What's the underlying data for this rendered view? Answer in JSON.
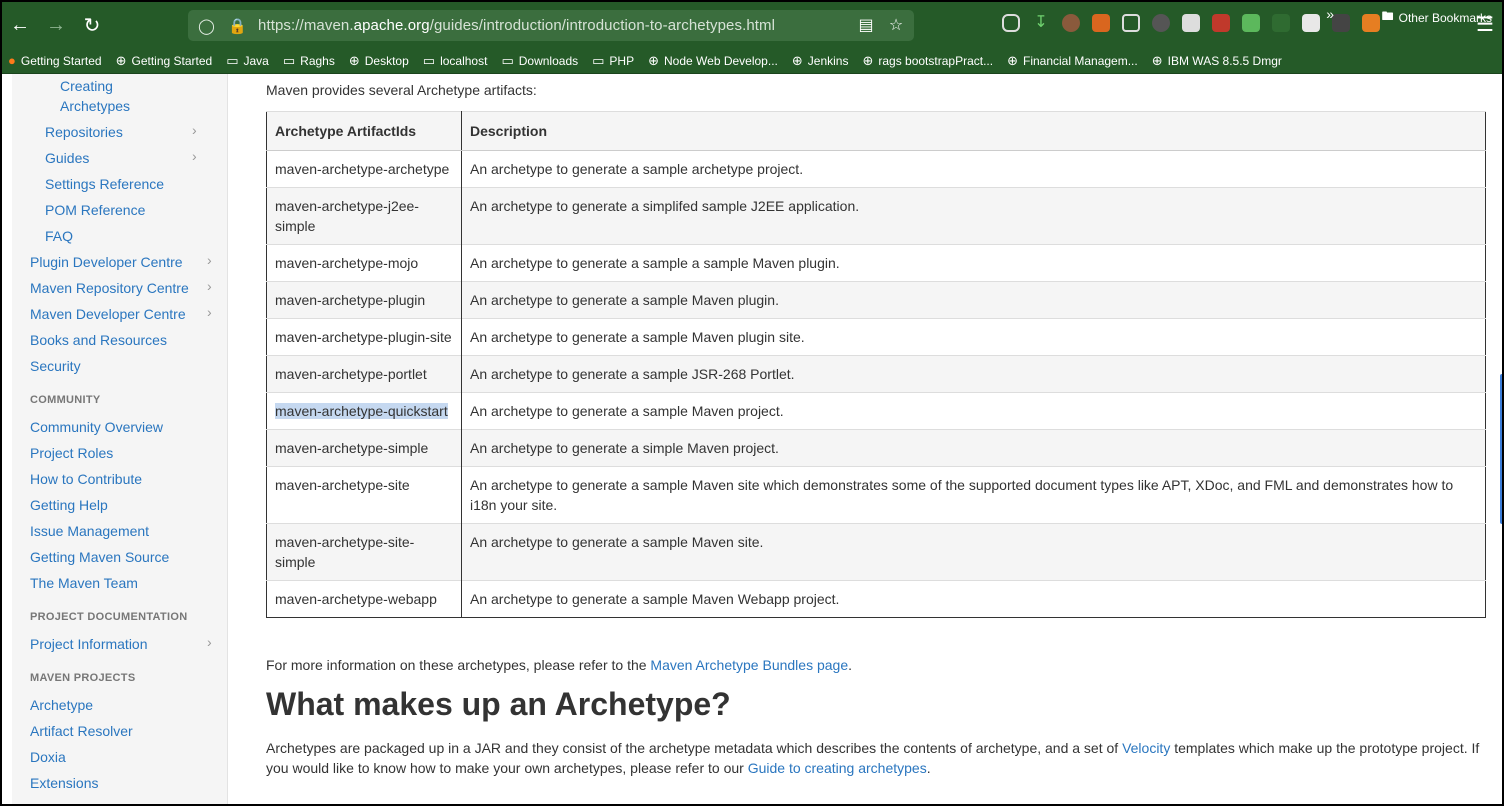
{
  "browser": {
    "url_prefix": "https://maven.",
    "url_host": "apache.org",
    "url_path": "/guides/introduction/introduction-to-archetypes.html",
    "bookmarks": [
      {
        "label": "Getting Started",
        "icon": "firefox-icon"
      },
      {
        "label": "Getting Started",
        "icon": "globe-icon"
      },
      {
        "label": "Java",
        "icon": "folder-icon"
      },
      {
        "label": "Raghs",
        "icon": "folder-icon"
      },
      {
        "label": "Desktop",
        "icon": "globe-icon"
      },
      {
        "label": "localhost",
        "icon": "folder-icon"
      },
      {
        "label": "Downloads",
        "icon": "folder-icon"
      },
      {
        "label": "PHP",
        "icon": "folder-icon"
      },
      {
        "label": "Node Web Develop...",
        "icon": "globe-icon"
      },
      {
        "label": "Jenkins",
        "icon": "globe-icon"
      },
      {
        "label": "rags bootstrapPract...",
        "icon": "globe-icon"
      },
      {
        "label": "Financial Managem...",
        "icon": "globe-icon"
      },
      {
        "label": "IBM WAS 8.5.5 Dmgr",
        "icon": "globe-icon"
      }
    ],
    "other_bookmarks": "Other Bookmarks"
  },
  "sidebar": {
    "creating_archetypes_1": "Creating",
    "creating_archetypes_2": "Archetypes",
    "repositories": "Repositories",
    "guides": "Guides",
    "settings_reference": "Settings Reference",
    "pom_reference": "POM Reference",
    "faq": "FAQ",
    "plugin_dev": "Plugin Developer Centre",
    "maven_repo": "Maven Repository Centre",
    "maven_dev": "Maven Developer Centre",
    "books": "Books and Resources",
    "security": "Security",
    "community_head": "COMMUNITY",
    "community_overview": "Community Overview",
    "project_roles": "Project Roles",
    "how_to_contribute": "How to Contribute",
    "getting_help": "Getting Help",
    "issue_mgmt": "Issue Management",
    "getting_source": "Getting Maven Source",
    "maven_team": "The Maven Team",
    "project_doc_head": "PROJECT DOCUMENTATION",
    "project_info": "Project Information",
    "maven_projects_head": "MAVEN PROJECTS",
    "archetype": "Archetype",
    "artifact_resolver": "Artifact Resolver",
    "doxia": "Doxia",
    "extensions": "Extensions"
  },
  "main": {
    "intro": "Maven provides several Archetype artifacts:",
    "table_headers": [
      "Archetype ArtifactIds",
      "Description"
    ],
    "rows": [
      [
        "maven-archetype-archetype",
        "An archetype to generate a sample archetype project."
      ],
      [
        "maven-archetype-j2ee-simple",
        "An archetype to generate a simplifed sample J2EE application."
      ],
      [
        "maven-archetype-mojo",
        "An archetype to generate a sample a sample Maven plugin."
      ],
      [
        "maven-archetype-plugin",
        "An archetype to generate a sample Maven plugin."
      ],
      [
        "maven-archetype-plugin-site",
        "An archetype to generate a sample Maven plugin site."
      ],
      [
        "maven-archetype-portlet",
        "An archetype to generate a sample JSR-268 Portlet."
      ],
      [
        "maven-archetype-quickstart",
        "An archetype to generate a sample Maven project."
      ],
      [
        "maven-archetype-simple",
        "An archetype to generate a simple Maven project."
      ],
      [
        "maven-archetype-site",
        "An archetype to generate a sample Maven site which demonstrates some of the supported document types like APT, XDoc, and FML and demonstrates how to i18n your site."
      ],
      [
        "maven-archetype-site-simple",
        "An archetype to generate a sample Maven site."
      ],
      [
        "maven-archetype-webapp",
        "An archetype to generate a sample Maven Webapp project."
      ]
    ],
    "more_prefix": "For more information on these archetypes, please refer to the ",
    "more_link": "Maven Archetype Bundles page",
    "more_suffix": ".",
    "heading": "What makes up an Archetype?",
    "para_1": "Archetypes are packaged up in a JAR and they consist of the archetype metadata which describes the contents of archetype, and a set of ",
    "para_velocity": "Velocity",
    "para_2": " templates which make up the prototype project. If you would like to know how to make your own archetypes, please refer to our ",
    "para_guide_link": "Guide to creating archetypes",
    "para_3": "."
  }
}
